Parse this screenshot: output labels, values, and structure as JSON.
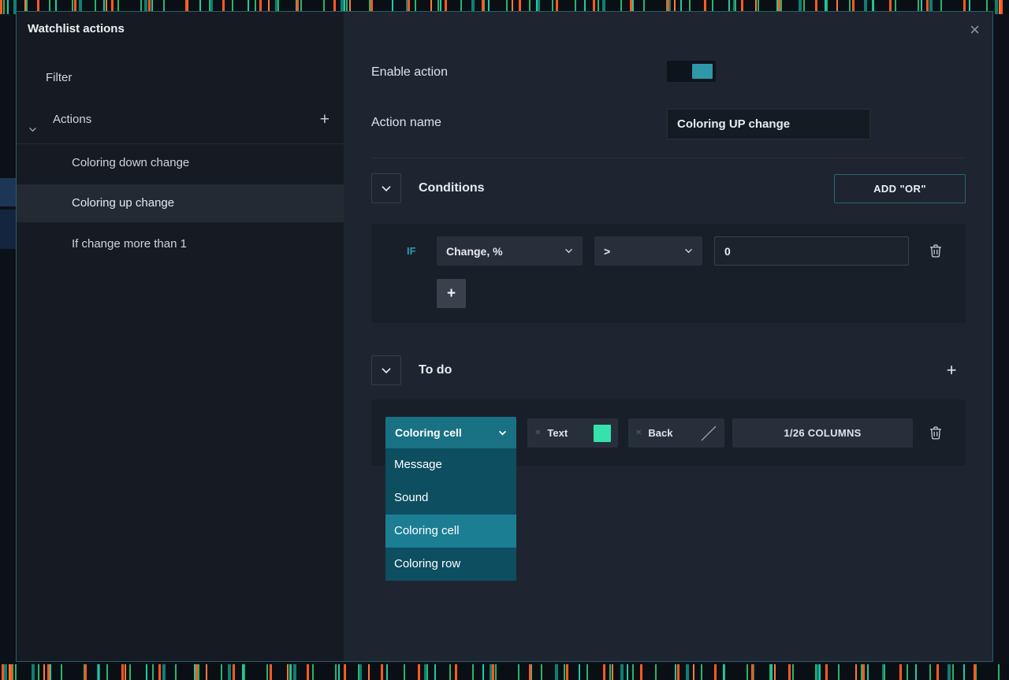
{
  "window": {
    "title": "Watchlist actions",
    "close_icon": "×"
  },
  "sidebar": {
    "filter_label": "Filter",
    "actions_label": "Actions",
    "actions_add": "+",
    "items": [
      {
        "label": "Coloring down change",
        "selected": false
      },
      {
        "label": "Coloring up change",
        "selected": true
      },
      {
        "label": "If change more than 1",
        "selected": false
      }
    ]
  },
  "form": {
    "enable_label": "Enable action",
    "enable_state": "on",
    "name_label": "Action name",
    "name_value": "Coloring UP change"
  },
  "conditions": {
    "title": "Conditions",
    "add_or_label": "ADD \"OR\"",
    "if_label": "IF",
    "field_value": "Change, %",
    "operator_value": ">",
    "value": "0",
    "add_label": "+"
  },
  "todo": {
    "title": "To do",
    "add_label": "+",
    "type_dropdown": {
      "value": "Coloring cell",
      "options": [
        "Message",
        "Sound",
        "Coloring cell",
        "Coloring row"
      ],
      "selected": "Coloring cell"
    },
    "text_button_label": "Text",
    "text_swatch_color": "#36e2ac",
    "back_button_label": "Back",
    "columns_button_label": "1/26 COLUMNS"
  },
  "colors": {
    "accent_teal": "#2f98a8",
    "dropdown_teal": "#197184",
    "dropdown_list_teal": "#0d4e61",
    "highlight_teal": "#1b7e93",
    "swatch_green": "#36e2ac",
    "tick_orange": "#ff5a1f",
    "tick_teal": "#1fc9a5"
  }
}
